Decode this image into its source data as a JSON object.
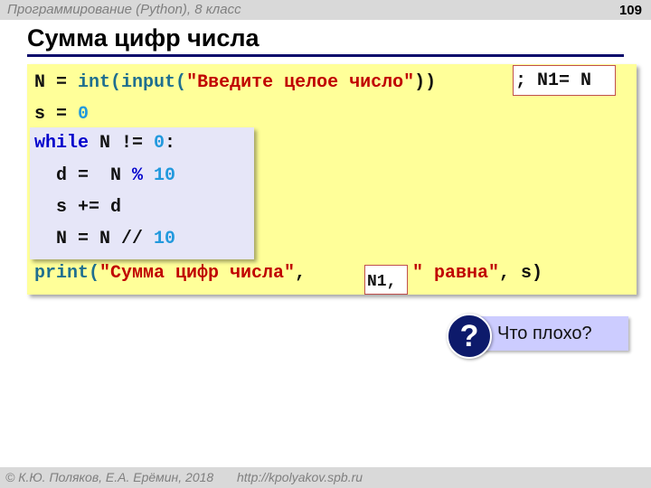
{
  "header": {
    "course": "Программирование (Python), 8 класс",
    "page_number": "109"
  },
  "slide": {
    "title": "Сумма цифр числа"
  },
  "code": {
    "line1": {
      "var": "N",
      "eq": " = ",
      "func_int": "int(",
      "func_input": "input(",
      "string": "\"Введите целое число\"",
      "close": "))",
      "insert": "; N1= N"
    },
    "line2": {
      "var": "s",
      "eq": " = ",
      "value": "0"
    },
    "loop": {
      "header_kw": "while",
      "header_rest": " N != ",
      "header_num": "0",
      "header_colon": ":",
      "body1_left": "  d =  N ",
      "body1_op": "%",
      "body1_num": " 10",
      "body2": "  s += d",
      "body3_left": "  N = N // ",
      "body3_num": "10"
    },
    "print_line": {
      "func": "print(",
      "string1": "\"Сумма цифр числа\"",
      "comma1": ",",
      "insert": "N1,",
      "string2": "\" равна\"",
      "tail": ", s)"
    }
  },
  "question": {
    "icon": "question-icon",
    "icon_glyph": "?",
    "label": "Что плохо?"
  },
  "footer": {
    "copyright": "© К.Ю. Поляков, Е.А. Ерёмин, 2018",
    "url": "http://kpolyakov.spb.ru"
  }
}
